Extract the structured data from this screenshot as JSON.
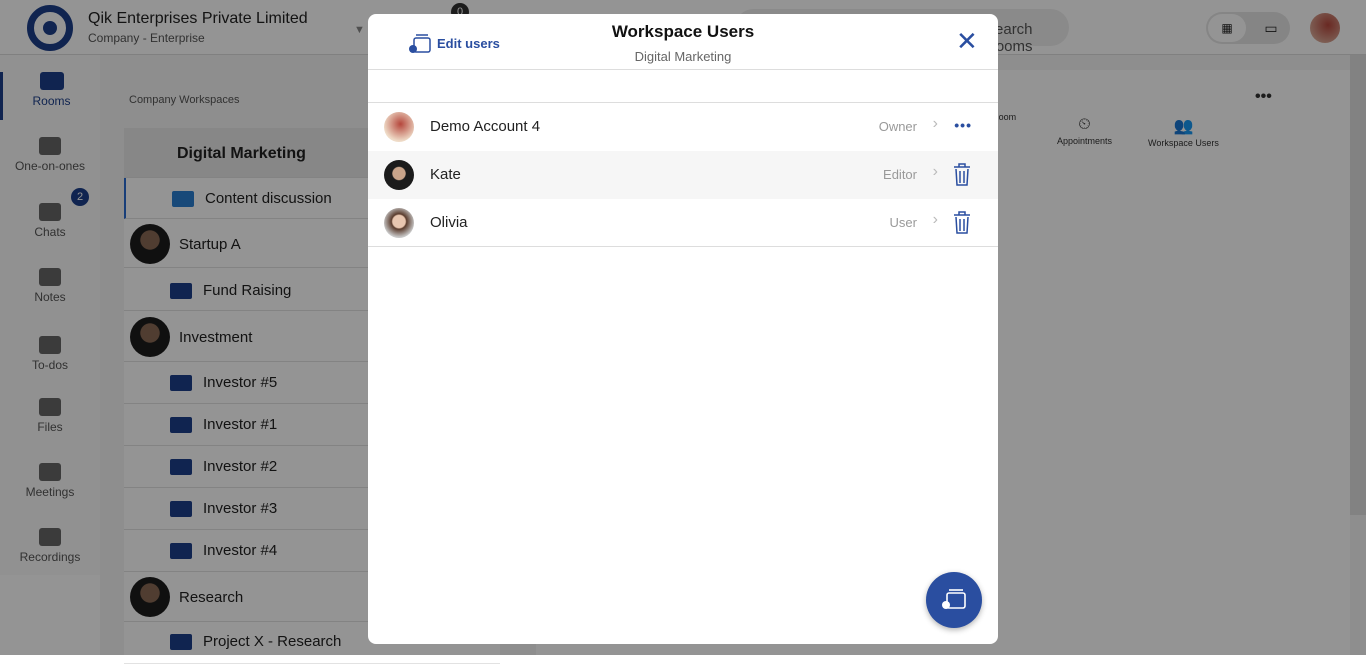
{
  "header": {
    "company": "Qik Enterprises Private Limited",
    "company_sub": "Company - Enterprise",
    "notif_count": "0",
    "search_placeholder": "Search Rooms"
  },
  "nav": [
    {
      "label": "Rooms",
      "icon": "rooms-icon"
    },
    {
      "label": "One-on-ones",
      "icon": "people-icon"
    },
    {
      "label": "Chats",
      "icon": "chat-icon",
      "badge": "2"
    },
    {
      "label": "Notes",
      "icon": "notes-icon"
    },
    {
      "label": "To-dos",
      "icon": "todo-icon"
    },
    {
      "label": "Files",
      "icon": "files-icon"
    },
    {
      "label": "Meetings",
      "icon": "meetings-icon"
    },
    {
      "label": "Recordings",
      "icon": "recordings-icon"
    }
  ],
  "workspaces": {
    "heading": "Company Workspaces",
    "items": [
      "Digital Marketing",
      "Content discussion",
      "Startup A",
      "Fund Raising",
      "Investment",
      "Investor #5",
      "Investor #1",
      "Investor #2",
      "Investor #3",
      "Investor #4",
      "Research",
      "Project X - Research"
    ]
  },
  "toolbar": {
    "waiting": "Waiting Room",
    "appointments": "Appointments",
    "workspace_users": "Workspace Users",
    "more": "•••"
  },
  "modal": {
    "title": "Workspace Users",
    "subtitle": "Digital Marketing",
    "edit_label": "Edit users",
    "users": [
      {
        "name": "Demo Account 4",
        "role": "Owner",
        "action": "more"
      },
      {
        "name": "Kate",
        "role": "Editor",
        "action": "delete"
      },
      {
        "name": "Olivia",
        "role": "User",
        "action": "delete"
      }
    ]
  },
  "colors": {
    "accent": "#2a4ea0",
    "brand": "#1d3f8a"
  }
}
